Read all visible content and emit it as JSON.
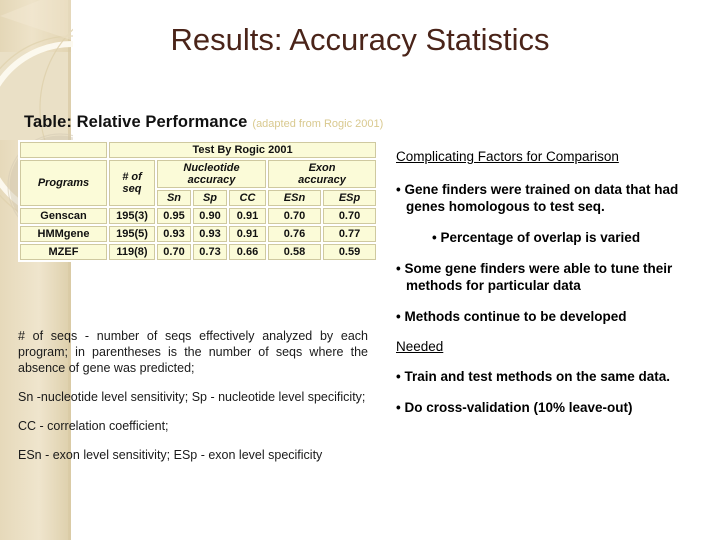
{
  "slide": {
    "title": "Results: Accuracy Statistics",
    "title_color": "#4a2419",
    "background_color": "#ffffff"
  },
  "caption": {
    "main": "Table: Relative Performance",
    "sub": "(adapted from Rogic 2001)",
    "sub_color": "#d9c98f"
  },
  "table": {
    "corner_blank": "",
    "super_header": "Test By Rogic 2001",
    "group_headers": {
      "programs": "Programs",
      "num_seq": "# of seq",
      "num_seq_line1": "# of",
      "num_seq_line2": "seq",
      "nucleotide": "Nucleotide accuracy",
      "nucleotide_line1": "Nucleotide",
      "nucleotide_line2": "accuracy",
      "exon": "Exon accuracy",
      "exon_line1": "Exon",
      "exon_line2": "accuracy"
    },
    "sub_headers": [
      "Sn",
      "Sp",
      "CC",
      "ESn",
      "ESp"
    ],
    "rows": [
      {
        "program": "Genscan",
        "num_seq": "195(3)",
        "sn": "0.95",
        "sp": "0.90",
        "cc": "0.91",
        "esn": "0.70",
        "esp": "0.70"
      },
      {
        "program": "HMMgene",
        "num_seq": "195(5)",
        "sn": "0.93",
        "sp": "0.93",
        "cc": "0.91",
        "esn": "0.76",
        "esp": "0.77"
      },
      {
        "program": "MZEF",
        "num_seq": "119(8)",
        "sn": "0.70",
        "sp": "0.73",
        "cc": "0.66",
        "esn": "0.58",
        "esp": "0.59"
      }
    ],
    "cell_background": "#fbfbd8",
    "cell_border": "#cfc9a0"
  },
  "legend": {
    "paragraphs": [
      "# of seqs - number of seqs effectively analyzed by each program; in parentheses is the number of seqs where the absence of gene was predicted;",
      "Sn -nucleotide level sensitivity; Sp - nucleotide level specificity;",
      "CC - correlation coefficient;",
      "ESn - exon level sensitivity; ESp - exon level specificity"
    ]
  },
  "right_column": {
    "heading_1": "Complicating Factors for Comparison",
    "bullets_1": [
      "• Gene finders were trained on data that had genes homologous to test seq.",
      "• Percentage of overlap is varied",
      "• Some gene finders were able to tune their methods for particular data",
      "• Methods continue to be developed"
    ],
    "heading_2": "Needed",
    "bullets_2": [
      "• Train and test methods on the same data.",
      "• Do cross-validation (10% leave-out)"
    ]
  },
  "decoration": {
    "panel_name": "beige-arc-panel",
    "base_color": "#e8dcc0",
    "light_color": "#f2e8d2",
    "arc_color": "#f7f0df"
  }
}
